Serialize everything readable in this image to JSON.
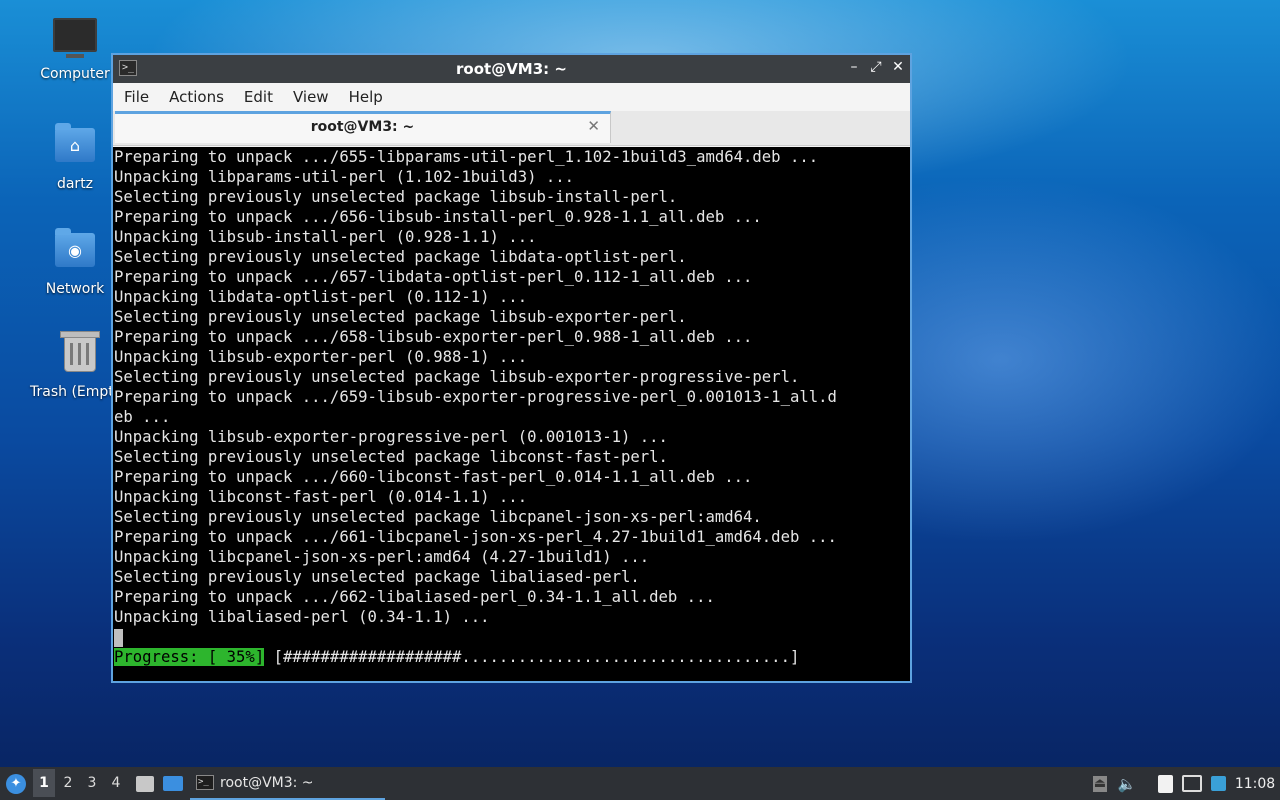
{
  "desktop": {
    "icons": [
      {
        "label": "Computer",
        "icon": "monitor-icon"
      },
      {
        "label": "dartz",
        "icon": "home-folder-icon"
      },
      {
        "label": "Network",
        "icon": "network-folder-icon"
      },
      {
        "label": "Trash (Empt",
        "icon": "trash-icon"
      }
    ]
  },
  "window": {
    "title": "root@VM3: ~",
    "controls": {
      "minimize": "–",
      "maximize": "⤢",
      "close": "✕"
    },
    "menu": [
      "File",
      "Actions",
      "Edit",
      "View",
      "Help"
    ],
    "tab": {
      "label": "root@VM3: ~",
      "close": "✕"
    }
  },
  "terminal": {
    "lines": [
      "Preparing to unpack .../655-libparams-util-perl_1.102-1build3_amd64.deb ...",
      "Unpacking libparams-util-perl (1.102-1build3) ...",
      "Selecting previously unselected package libsub-install-perl.",
      "Preparing to unpack .../656-libsub-install-perl_0.928-1.1_all.deb ...",
      "Unpacking libsub-install-perl (0.928-1.1) ...",
      "Selecting previously unselected package libdata-optlist-perl.",
      "Preparing to unpack .../657-libdata-optlist-perl_0.112-1_all.deb ...",
      "Unpacking libdata-optlist-perl (0.112-1) ...",
      "Selecting previously unselected package libsub-exporter-perl.",
      "Preparing to unpack .../658-libsub-exporter-perl_0.988-1_all.deb ...",
      "Unpacking libsub-exporter-perl (0.988-1) ...",
      "Selecting previously unselected package libsub-exporter-progressive-perl.",
      "Preparing to unpack .../659-libsub-exporter-progressive-perl_0.001013-1_all.d",
      "eb ...",
      "Unpacking libsub-exporter-progressive-perl (0.001013-1) ...",
      "Selecting previously unselected package libconst-fast-perl.",
      "Preparing to unpack .../660-libconst-fast-perl_0.014-1.1_all.deb ...",
      "Unpacking libconst-fast-perl (0.014-1.1) ...",
      "Selecting previously unselected package libcpanel-json-xs-perl:amd64.",
      "Preparing to unpack .../661-libcpanel-json-xs-perl_4.27-1build1_amd64.deb ...",
      "Unpacking libcpanel-json-xs-perl:amd64 (4.27-1build1) ...",
      "Selecting previously unselected package libaliased-perl.",
      "Preparing to unpack .../662-libaliased-perl_0.34-1.1_all.deb ...",
      "Unpacking libaliased-perl (0.34-1.1) ..."
    ],
    "progress_label": "Progress: [ 35%]",
    "progress_bar": "[###################...................................]",
    "progress_fraction": 0.35
  },
  "taskbar": {
    "workspaces": [
      "1",
      "2",
      "3",
      "4"
    ],
    "active_workspace": "1",
    "task_label": "root@VM3: ~",
    "clock": "11:08"
  }
}
